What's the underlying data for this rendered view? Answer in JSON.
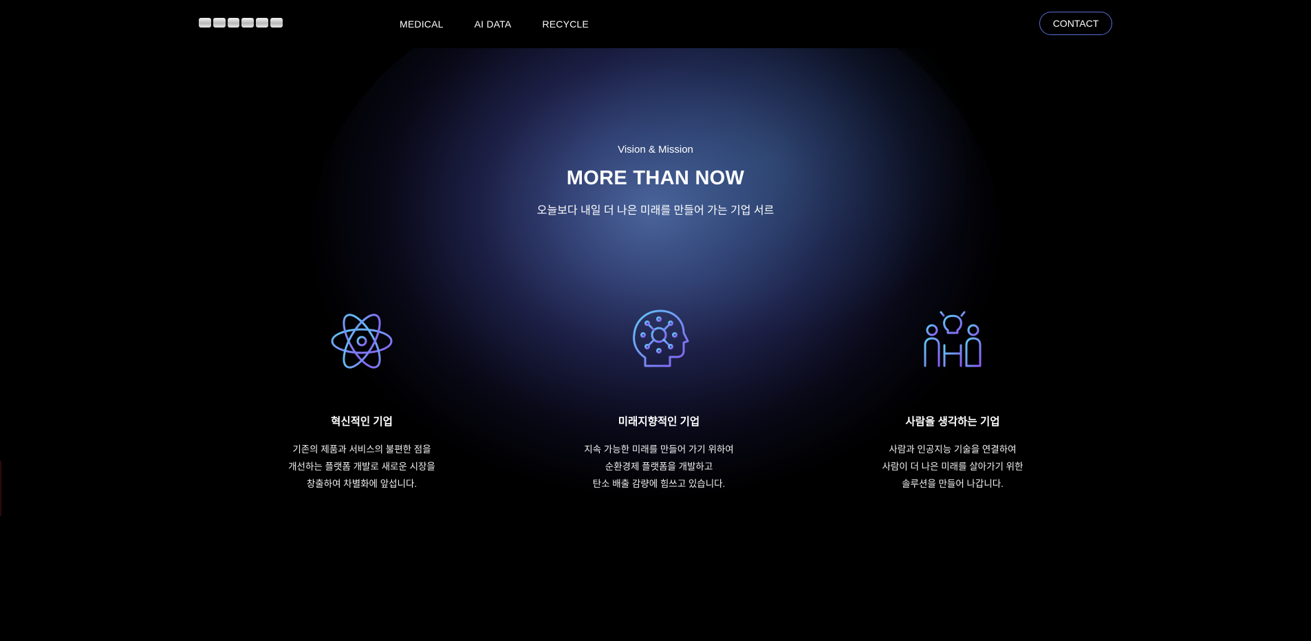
{
  "header": {
    "logo_text": "SEOREU",
    "nav": [
      {
        "label": "MEDICAL"
      },
      {
        "label": "AI DATA"
      },
      {
        "label": "RECYCLE"
      }
    ],
    "contact_label": "CONTACT"
  },
  "hero": {
    "eyebrow": "Vision & Mission",
    "headline": "MORE THAN NOW",
    "subhead": "오늘보다 내일 더 나은 미래를 만들어 가는 기업 서르"
  },
  "features": [
    {
      "icon": "atom-icon",
      "title": "혁신적인 기업",
      "lines": [
        "기존의 제품과 서비스의 불편한 점을",
        "개선하는 플랫폼 개발로 새로운 시장을",
        "창출하여 차별화에 앞섭니다."
      ]
    },
    {
      "icon": "brain-head-icon",
      "title": "미래지향적인 기업",
      "lines": [
        "지속 가능한 미래를 만들어 가기 위하여",
        "순환경제 플랫폼을 개발하고",
        "탄소 배출 감량에 힘쓰고 있습니다."
      ]
    },
    {
      "icon": "people-idea-icon",
      "title": "사람을 생각하는 기업",
      "lines": [
        "사람과 인공지능 기술을 연결하여",
        "사람이 더 나은 미래를 살아가기 위한",
        "솔루션을 만들어 나갑니다."
      ]
    }
  ],
  "colors": {
    "background": "#000000",
    "accent_border": "#5a6fd8",
    "icon_gradient_start": "#5ec9f5",
    "icon_gradient_end": "#8b5cf6",
    "glow": "#4f6aa8"
  }
}
